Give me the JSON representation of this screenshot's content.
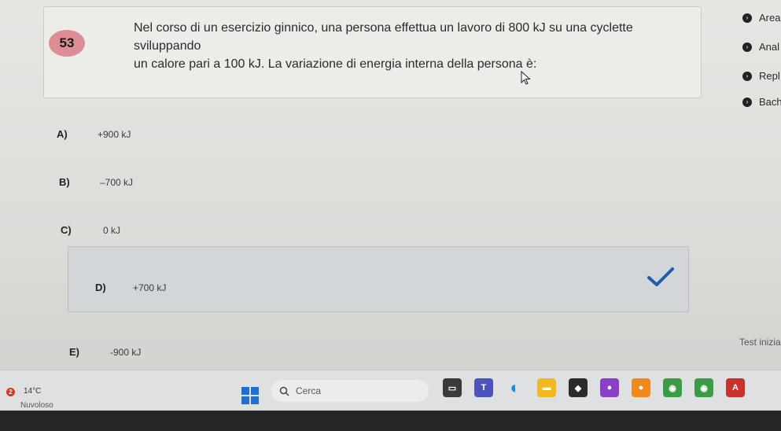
{
  "question": {
    "number": "53",
    "line1": "Nel corso di un esercizio ginnico, una persona effettua un lavoro di 800 kJ su una cyclette sviluppando",
    "line2": "un calore pari a 100 kJ. La variazione di energia interna della persona è:"
  },
  "side_menu": {
    "items": [
      {
        "label": "Area"
      },
      {
        "label": "Anal"
      },
      {
        "label": "Repl"
      },
      {
        "label": "Bach"
      }
    ]
  },
  "options": [
    {
      "letter": "A)",
      "value": "+900 kJ"
    },
    {
      "letter": "B)",
      "value": "–700 kJ"
    },
    {
      "letter": "C)",
      "value": "0 kJ"
    },
    {
      "letter": "D)",
      "value": "+700 kJ"
    },
    {
      "letter": "E)",
      "value": "-900 kJ"
    }
  ],
  "selected_option": "D)",
  "status": {
    "test_started": "Test inizia"
  },
  "taskbar": {
    "weather_badge": "2",
    "temperature": "14°C",
    "condition": "Nuvoloso",
    "search_label": "Cerca"
  },
  "colors": {
    "number_badge": "#dd8d93",
    "selected_option_bg": "#d3d6d8",
    "check": "#1f5fa8"
  }
}
